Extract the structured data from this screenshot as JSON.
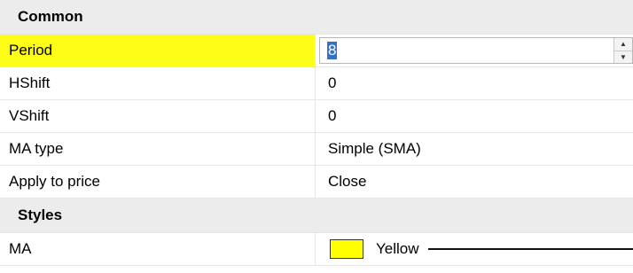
{
  "sections": {
    "common": "Common",
    "styles": "Styles"
  },
  "rows": {
    "period": {
      "label": "Period",
      "value": "8"
    },
    "hshift": {
      "label": "HShift",
      "value": "0"
    },
    "vshift": {
      "label": "VShift",
      "value": "0"
    },
    "ma_type": {
      "label": "MA type",
      "value": "Simple (SMA)"
    },
    "apply_to_price": {
      "label": "Apply to price",
      "value": "Close"
    },
    "ma_style": {
      "label": "MA",
      "color_name": "Yellow",
      "color": "#ffff00"
    }
  },
  "icons": {
    "spinner_up": "up-arrow-icon",
    "spinner_down": "down-arrow-icon"
  },
  "colors": {
    "selected_highlight": "#fdfd18",
    "text_selection": "#3572c7",
    "section_background": "#ececec"
  }
}
